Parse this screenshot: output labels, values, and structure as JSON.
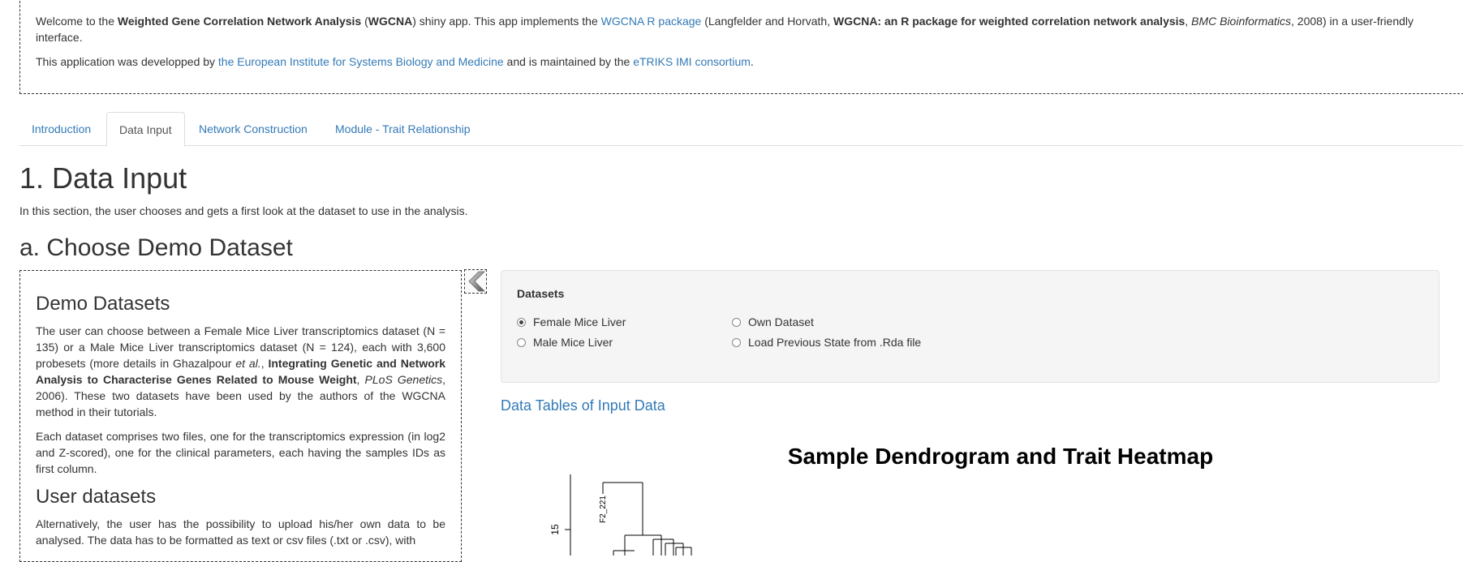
{
  "intro": {
    "p1": {
      "t1": "Welcome to the ",
      "b1": "Weighted Gene Correlation Network Analysis",
      "t2": " (",
      "b2": "WGCNA",
      "t3": ") shiny app. This app implements the ",
      "link": "WGCNA R package",
      "t4": " (Langfelder and Horvath, ",
      "b3": "WGCNA: an R package for weighted correlation network analysis",
      "t5": ", ",
      "i1": "BMC Bioinformatics",
      "t6": ", 2008) in a user-friendly interface."
    },
    "p2": {
      "t1": "This application was developped by ",
      "link1": "the European Institute for Systems Biology and Medicine",
      "t2": " and is maintained by the ",
      "link2": "eTRIKS IMI consortium",
      "t3": "."
    }
  },
  "tabs": [
    "Introduction",
    "Data Input",
    "Network Construction",
    "Module - Trait Relationship"
  ],
  "active_tab": "Data Input",
  "page": {
    "title": "1. Data Input",
    "lead": "In this section, the user chooses and gets a first look at the dataset to use in the analysis.",
    "section": "a. Choose Demo Dataset"
  },
  "sidebar": {
    "h1": "Demo Datasets",
    "p1": {
      "t1": "The user can choose between a Female Mice Liver transcriptomics dataset (N = 135) or a Male Mice Liver transcriptomics dataset (N = 124), each with 3,600 probesets (more details in Ghazalpour ",
      "i1": "et al.",
      "t2": ", ",
      "b1": "Integrating Genetic and Network Analysis to Characterise Genes Related to Mouse Weight",
      "t3": ", ",
      "i2": "PLoS Genetics",
      "t4": ", 2006). These two datasets have been used by the authors of the WGCNA method in their tutorials."
    },
    "p2": "Each dataset comprises two files, one for the transcriptomics expression (in log2 and Z-scored), one for the clinical parameters, each having the samples IDs as first column.",
    "h2": "User datasets",
    "p3": "Alternatively, the user has the possibility to upload his/her own data to be analysed. The data has to be formatted as text or csv files (.txt or .csv), with"
  },
  "datasets": {
    "label": "Datasets",
    "options": [
      "Female Mice Liver",
      "Male Mice Liver",
      "Own Dataset",
      "Load Previous State from .Rda file"
    ],
    "selected": "Female Mice Liver"
  },
  "tables_link": "Data Tables of Input Data",
  "plot": {
    "title": "Sample Dendrogram and Trait Heatmap",
    "ytick": "15",
    "leaf_label": "F2_221"
  }
}
